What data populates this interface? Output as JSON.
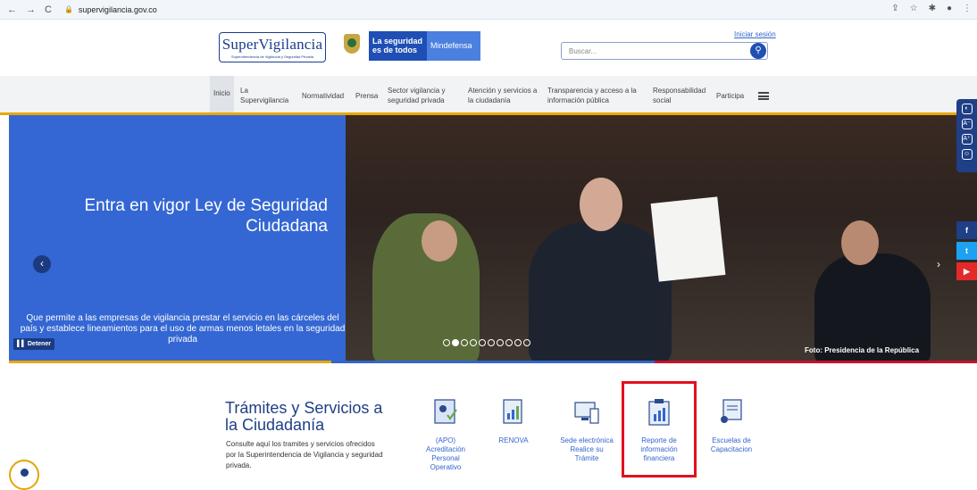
{
  "browser": {
    "url": "supervigilancia.gov.co",
    "nav_back": "←",
    "nav_forward": "→",
    "nav_reload": "C",
    "lock": "🔒",
    "right_icons": [
      "share-icon",
      "star-icon",
      "extension-icon",
      "profile-icon",
      "menu-icon"
    ]
  },
  "header": {
    "logo_text": "SuperVigilancia",
    "logo_subtext": "Superintendencia de Vigilancia y Seguridad Privada",
    "govbrand_a": "La seguridad es de todos",
    "govbrand_b": "Mindefensa",
    "login": "Iniciar sesión",
    "search_placeholder": "Buscar..."
  },
  "menu": {
    "items": [
      "Inicio",
      "La Supervigilancia",
      "Normatividad",
      "Prensa",
      "Sector vigilancia y seguridad privada",
      "Atención y servicios a la ciudadanía",
      "Transparencia y acceso a la información pública",
      "Responsabilidad social",
      "Participa"
    ]
  },
  "hero": {
    "title": "Entra en vigor Ley de Seguridad Ciudadana",
    "subtitle": "Que permite a las empresas de vigilancia prestar el servicio en las cárceles del país y establece lineamientos para el uso de armas menos letales en la seguridad privada",
    "stop_label": "Detener",
    "credit": "Foto: Presidencia de la República",
    "dots_count": 10,
    "active_dot": 1
  },
  "colors": {
    "primary": "#3366cc",
    "dark": "#1f3f86",
    "accent": "#e8a800",
    "highlight": "#e2101e"
  },
  "services": {
    "title": "Trámites y Servicios a la Ciudadanía",
    "description": "Consulte aquí los tramites y servicios ofrecidos por la Superintendencia de Vigilancia y seguridad privada.",
    "items": [
      {
        "label": "(APO) Acreditación Personal Operativo",
        "icon": "badge-check-icon"
      },
      {
        "label": "RENOVA",
        "icon": "chart-document-icon"
      },
      {
        "label": "Sede electrónica Realice su Trámite",
        "icon": "computer-icon"
      },
      {
        "label": "Reporte de información financiera",
        "icon": "financial-report-icon"
      },
      {
        "label": "Escuelas de Capacitacion",
        "icon": "training-icon"
      }
    ]
  },
  "social": [
    "f",
    "t",
    "▶"
  ]
}
